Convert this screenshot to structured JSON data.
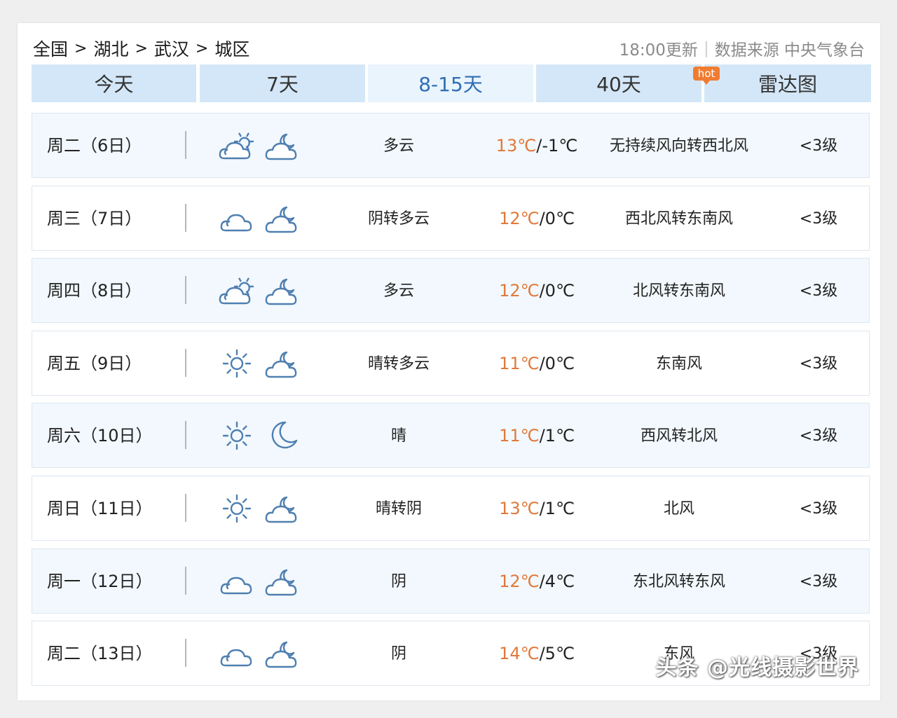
{
  "breadcrumb": {
    "items": [
      "全国",
      "湖北",
      "武汉",
      "城区"
    ],
    "separator": ">"
  },
  "meta": {
    "update": "18:00更新",
    "divider": "|",
    "source": "数据来源 中央气象台"
  },
  "tabs": [
    {
      "label": "今天"
    },
    {
      "label": "7天"
    },
    {
      "label": "8-15天"
    },
    {
      "label": "40天"
    },
    {
      "label": "雷达图"
    }
  ],
  "hot_badge": "hot",
  "forecast": [
    {
      "day": "周二（6日）",
      "icon1": "partly-cloudy-sun-icon",
      "icon2": "cloud-moon-icon",
      "condition": "多云",
      "high": "13℃",
      "low": "/-1℃",
      "wind": "无持续风向转西北风",
      "level": "<3级"
    },
    {
      "day": "周三（7日）",
      "icon1": "overcast-cloud-icon",
      "icon2": "cloud-moon-icon",
      "condition": "阴转多云",
      "high": "12℃",
      "low": "/0℃",
      "wind": "西北风转东南风",
      "level": "<3级"
    },
    {
      "day": "周四（8日）",
      "icon1": "partly-cloudy-sun-icon",
      "icon2": "cloud-moon-icon",
      "condition": "多云",
      "high": "12℃",
      "low": "/0℃",
      "wind": "北风转东南风",
      "level": "<3级"
    },
    {
      "day": "周五（9日）",
      "icon1": "sun-icon",
      "icon2": "cloud-moon-icon",
      "condition": "晴转多云",
      "high": "11℃",
      "low": "/0℃",
      "wind": "东南风",
      "level": "<3级"
    },
    {
      "day": "周六（10日）",
      "icon1": "sun-icon",
      "icon2": "crescent-moon-icon",
      "condition": "晴",
      "high": "11℃",
      "low": "/1℃",
      "wind": "西风转北风",
      "level": "<3级"
    },
    {
      "day": "周日（11日）",
      "icon1": "sun-icon",
      "icon2": "cloud-moon-icon",
      "condition": "晴转阴",
      "high": "13℃",
      "low": "/1℃",
      "wind": "北风",
      "level": "<3级"
    },
    {
      "day": "周一（12日）",
      "icon1": "overcast-cloud-icon",
      "icon2": "cloud-moon-icon",
      "condition": "阴",
      "high": "12℃",
      "low": "/4℃",
      "wind": "东北风转东风",
      "level": "<3级"
    },
    {
      "day": "周二（13日）",
      "icon1": "overcast-cloud-icon",
      "icon2": "cloud-moon-icon",
      "condition": "阴",
      "high": "14℃",
      "low": "/5℃",
      "wind": "东风",
      "level": "<3级"
    }
  ],
  "watermark": "头条 @光线摄影世界",
  "colors": {
    "tab_bg": "#d4e7f8",
    "tab_active_text": "#2f6eb5",
    "high_temp": "#e0793a",
    "icon_stroke": "#4f7fb0",
    "row_alt_bg": "#f2f8fd"
  }
}
